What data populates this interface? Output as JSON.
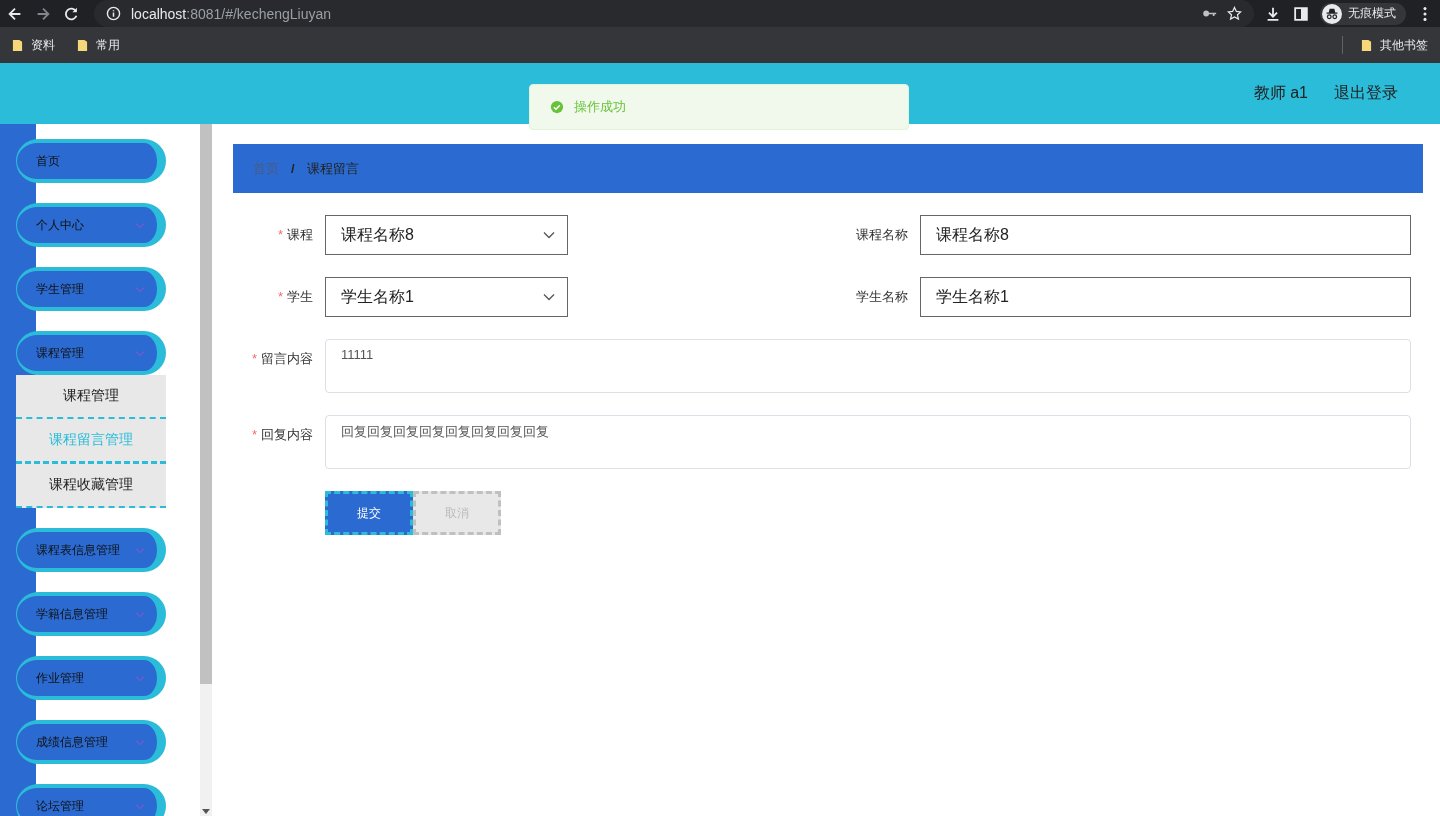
{
  "browser": {
    "url_host": "localhost",
    "url_path": ":8081/#/kechengLiuyan",
    "forward_enabled": false,
    "profile": "无痕模式",
    "bookmarks": [
      "资料",
      "常用"
    ],
    "other_bookmarks": "其他书签"
  },
  "header": {
    "user": "教师 a1",
    "logout": "退出登录"
  },
  "toast": {
    "message": "操作成功"
  },
  "sidebar": {
    "items": [
      {
        "label": "首页",
        "expandable": false,
        "expanded": false
      },
      {
        "label": "个人中心",
        "expandable": true,
        "expanded": false
      },
      {
        "label": "学生管理",
        "expandable": true,
        "expanded": false
      },
      {
        "label": "课程管理",
        "expandable": true,
        "expanded": true,
        "children": [
          {
            "label": "课程管理",
            "selected": false
          },
          {
            "label": "课程留言管理",
            "selected": true
          },
          {
            "label": "课程收藏管理",
            "selected": false
          }
        ]
      },
      {
        "label": "课程表信息管理",
        "expandable": true,
        "expanded": false
      },
      {
        "label": "学籍信息管理",
        "expandable": true,
        "expanded": false
      },
      {
        "label": "作业管理",
        "expandable": true,
        "expanded": false
      },
      {
        "label": "成绩信息管理",
        "expandable": true,
        "expanded": false
      },
      {
        "label": "论坛管理",
        "expandable": true,
        "expanded": false
      }
    ]
  },
  "breadcrumb": {
    "items": [
      "首页",
      "课程留言"
    ],
    "separator": "/"
  },
  "form": {
    "rows": [
      [
        {
          "label": "课程",
          "required_mark": "*",
          "kind": "select",
          "value": "课程名称8"
        },
        {
          "label": "课程名称",
          "kind": "input",
          "value": "课程名称8"
        }
      ],
      [
        {
          "label": "学生",
          "required_mark": "*",
          "kind": "select",
          "value": "学生名称1"
        },
        {
          "label": "学生名称",
          "kind": "input",
          "value": "学生名称1"
        }
      ],
      [
        {
          "label": "留言内容",
          "required_mark": "*",
          "kind": "textarea",
          "value": "11111"
        }
      ],
      [
        {
          "label": "回复内容",
          "required_mark": "*",
          "kind": "textarea",
          "value": "回复回复回复回复回复回复回复回复"
        }
      ]
    ],
    "buttons": [
      {
        "label": "提交",
        "kind": "primary"
      },
      {
        "label": "取消",
        "kind": "cancel"
      }
    ]
  }
}
